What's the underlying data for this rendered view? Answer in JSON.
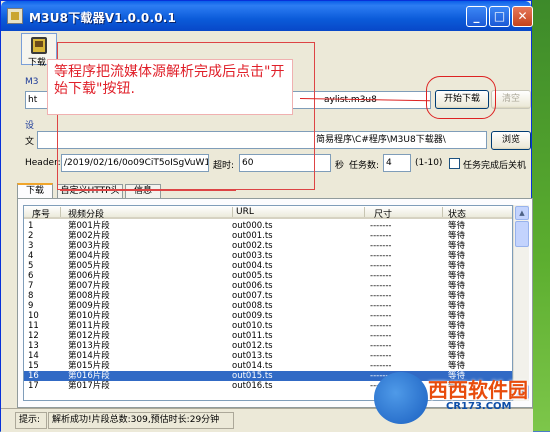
{
  "window": {
    "title": "M3U8下载器V1.0.0.0.1",
    "controls": {
      "minimize": "_",
      "maximize": "□",
      "close": "✕"
    }
  },
  "toolbar": {
    "download_label": "下载"
  },
  "form": {
    "url_label_partial": "M3",
    "url_value_prefix": "ht",
    "url_value_suffix": "aylist.m3u8",
    "start_button": "开始下载",
    "clear_button": "清空",
    "save_label_partial": "设",
    "folder_label_partial": "文",
    "folder_value": "简易程序\\C#程序\\M3U8下载器\\",
    "browse_button": "浏览",
    "header_label": "Header:",
    "header_value": "/2019/02/16/0o09CiT5oISgVuW1/",
    "timeout_label": "超时:",
    "timeout_value": "60",
    "seconds_label": "秒",
    "tasks_label": "任务数:",
    "tasks_value": "4",
    "tasks_range": "(1-10)",
    "shutdown_label": "任务完成后关机"
  },
  "tabs": [
    {
      "label": "下载",
      "active": true
    },
    {
      "label": "自定义HTTP头",
      "active": false
    },
    {
      "label": "信息",
      "active": false
    }
  ],
  "list": {
    "columns": [
      "序号",
      "视频分段",
      "URL",
      "尺寸",
      "状态"
    ],
    "rows": [
      {
        "idx": "1",
        "seg": "第001片段",
        "url": "out000.ts",
        "size": "-------",
        "status": "等待"
      },
      {
        "idx": "2",
        "seg": "第002片段",
        "url": "out001.ts",
        "size": "-------",
        "status": "等待"
      },
      {
        "idx": "3",
        "seg": "第003片段",
        "url": "out002.ts",
        "size": "-------",
        "status": "等待"
      },
      {
        "idx": "4",
        "seg": "第004片段",
        "url": "out003.ts",
        "size": "-------",
        "status": "等待"
      },
      {
        "idx": "5",
        "seg": "第005片段",
        "url": "out004.ts",
        "size": "-------",
        "status": "等待"
      },
      {
        "idx": "6",
        "seg": "第006片段",
        "url": "out005.ts",
        "size": "-------",
        "status": "等待"
      },
      {
        "idx": "7",
        "seg": "第007片段",
        "url": "out006.ts",
        "size": "-------",
        "status": "等待"
      },
      {
        "idx": "8",
        "seg": "第008片段",
        "url": "out007.ts",
        "size": "-------",
        "status": "等待"
      },
      {
        "idx": "9",
        "seg": "第009片段",
        "url": "out008.ts",
        "size": "-------",
        "status": "等待"
      },
      {
        "idx": "10",
        "seg": "第010片段",
        "url": "out009.ts",
        "size": "-------",
        "status": "等待"
      },
      {
        "idx": "11",
        "seg": "第011片段",
        "url": "out010.ts",
        "size": "-------",
        "status": "等待"
      },
      {
        "idx": "12",
        "seg": "第012片段",
        "url": "out011.ts",
        "size": "-------",
        "status": "等待"
      },
      {
        "idx": "13",
        "seg": "第013片段",
        "url": "out012.ts",
        "size": "-------",
        "status": "等待"
      },
      {
        "idx": "14",
        "seg": "第014片段",
        "url": "out013.ts",
        "size": "-------",
        "status": "等待"
      },
      {
        "idx": "15",
        "seg": "第015片段",
        "url": "out014.ts",
        "size": "-------",
        "status": "等待"
      },
      {
        "idx": "16",
        "seg": "第016片段",
        "url": "out015.ts",
        "size": "-------",
        "status": "等待",
        "selected": true
      },
      {
        "idx": "17",
        "seg": "第017片段",
        "url": "out016.ts",
        "size": "-------",
        "status": "等待"
      }
    ]
  },
  "status": {
    "hint_label": "提示:",
    "message": "解析成功!片段总数:309,预估时长:29分钟"
  },
  "annotation": {
    "callout_text": "等程序把流媒体源解析完成后点击\"开始下载\"按钮."
  },
  "watermark": {
    "brand": "西西软件园",
    "url": "CR173.COM"
  },
  "colors": {
    "selection": "#316ac5",
    "annotation_red": "#e0202a",
    "title_blue": "#0b5bd9"
  }
}
